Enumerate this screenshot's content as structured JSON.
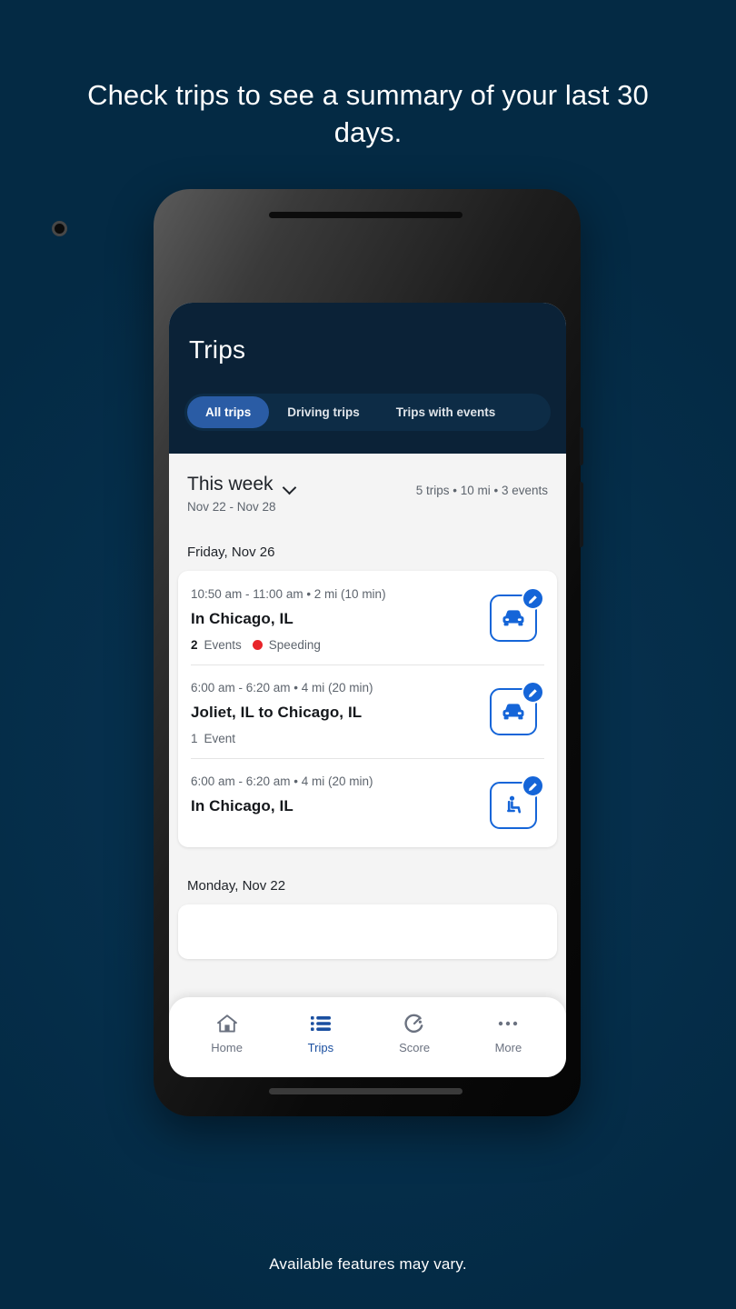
{
  "promo": {
    "headline": "Check trips to see a summary of your last 30 days.",
    "footnote": "Available features may vary."
  },
  "app": {
    "header": {
      "title": "Trips",
      "tabs": [
        {
          "label": "All trips",
          "selected": true
        },
        {
          "label": "Driving trips",
          "selected": false
        },
        {
          "label": "Trips with events",
          "selected": false
        }
      ]
    },
    "summary": {
      "range_label": "This week",
      "range_dates": "Nov 22 - Nov 28",
      "stats": "5 trips • 10 mi • 3 events",
      "chevron_icon": "chevron-down-icon"
    },
    "groups": [
      {
        "day": "Friday, Nov 26",
        "trips": [
          {
            "time": "10:50 am - 11:00 am • 2 mi (10 min)",
            "title": "In Chicago, IL",
            "events_count": "2",
            "events_label": "Events",
            "event_type": "Speeding",
            "event_color": "#e8252a",
            "icon": "car-icon",
            "badge_icon": "edit-pencil-icon"
          },
          {
            "time": "6:00 am - 6:20 am • 4 mi (20 min)",
            "title": "Joliet, IL to Chicago, IL",
            "events_count": "1",
            "events_label": "Event",
            "event_type": "",
            "icon": "car-icon",
            "badge_icon": "edit-pencil-icon"
          },
          {
            "time": "6:00 am - 6:20 am • 4 mi (20 min)",
            "title": "In Chicago, IL",
            "events_count": "",
            "events_label": "",
            "event_type": "",
            "icon": "passenger-seat-icon",
            "badge_icon": "edit-pencil-icon"
          }
        ]
      },
      {
        "day": "Monday, Nov 22",
        "trips": []
      }
    ],
    "bottom_nav": [
      {
        "label": "Home",
        "icon": "home-icon",
        "active": false
      },
      {
        "label": "Trips",
        "icon": "list-icon",
        "active": true
      },
      {
        "label": "Score",
        "icon": "gauge-icon",
        "active": false
      },
      {
        "label": "More",
        "icon": "more-dots-icon",
        "active": false
      }
    ]
  },
  "colors": {
    "background": "#042a44",
    "app_header": "#0b2237",
    "accent_blue": "#1565d8",
    "tab_active": "#2a5ca5",
    "nav_active": "#1a4fa0"
  }
}
